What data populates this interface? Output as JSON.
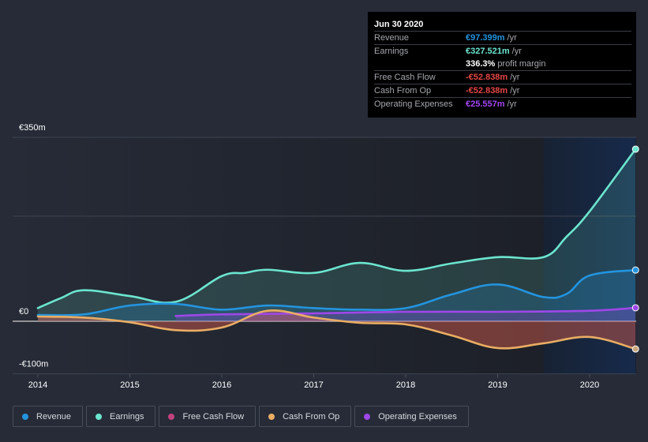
{
  "tooltip": {
    "date": "Jun 30 2020",
    "rows": [
      {
        "label": "Revenue",
        "value": "€97.399m",
        "unit": "/yr",
        "color": "#2394df"
      },
      {
        "label": "Earnings",
        "value": "€327.521m",
        "unit": "/yr",
        "color": "#6ce5cf"
      },
      {
        "label": "",
        "value": "336.3%",
        "unit": "profit margin",
        "color": "#ffffff"
      },
      {
        "label": "Free Cash Flow",
        "value": "-€52.838m",
        "unit": "/yr",
        "color": "#e64646"
      },
      {
        "label": "Cash From Op",
        "value": "-€52.838m",
        "unit": "/yr",
        "color": "#e64646"
      },
      {
        "label": "Operating Expenses",
        "value": "€25.557m",
        "unit": "/yr",
        "color": "#a346f0"
      }
    ]
  },
  "legend": [
    {
      "label": "Revenue",
      "color": "#2394df"
    },
    {
      "label": "Earnings",
      "color": "#6ce5cf"
    },
    {
      "label": "Free Cash Flow",
      "color": "#c2427f"
    },
    {
      "label": "Cash From Op",
      "color": "#e9ad63"
    },
    {
      "label": "Operating Expenses",
      "color": "#9e47e8"
    }
  ],
  "chart_data": {
    "type": "area",
    "title": "",
    "xlabel": "",
    "ylabel": "",
    "currency": "EUR",
    "xlim": [
      2013.7,
      2020.5
    ],
    "ylim": [
      -100,
      350
    ],
    "y_ticks": [
      {
        "value": 350,
        "label": "€350m"
      },
      {
        "value": 0,
        "label": "€0"
      },
      {
        "value": -100,
        "label": "-€100m"
      }
    ],
    "gridlines": [
      350,
      200,
      0,
      -100
    ],
    "x_ticks": [
      {
        "value": 2014,
        "label": "2014"
      },
      {
        "value": 2015,
        "label": "2015"
      },
      {
        "value": 2016,
        "label": "2016"
      },
      {
        "value": 2017,
        "label": "2017"
      },
      {
        "value": 2018,
        "label": "2018"
      },
      {
        "value": 2019,
        "label": "2019"
      },
      {
        "value": 2020,
        "label": "2020"
      }
    ],
    "highlight_range": [
      2019.5,
      2020.5
    ],
    "legend_position": "bottom-left",
    "series": [
      {
        "name": "Earnings",
        "color": "#6ce5cf",
        "x": [
          2014.0,
          2014.25,
          2014.5,
          2015.0,
          2015.5,
          2016.0,
          2016.25,
          2016.5,
          2017.0,
          2017.5,
          2018.0,
          2018.5,
          2019.0,
          2019.5,
          2019.75,
          2020.0,
          2020.5
        ],
        "values": [
          25,
          44,
          59,
          48,
          37,
          86,
          92,
          98,
          92,
          111,
          96,
          110,
          122,
          122,
          161,
          209,
          327.5
        ]
      },
      {
        "name": "Revenue",
        "color": "#2394df",
        "x": [
          2014.0,
          2014.5,
          2015.0,
          2015.5,
          2016.0,
          2016.5,
          2017.0,
          2017.5,
          2018.0,
          2018.5,
          2019.0,
          2019.5,
          2019.75,
          2020.0,
          2020.5
        ],
        "values": [
          12,
          13,
          30,
          33,
          22,
          30,
          25,
          22,
          25,
          51,
          70,
          46,
          52,
          87,
          97.4
        ]
      },
      {
        "name": "Free Cash Flow",
        "color": "#c2427f",
        "x": [
          2014.0,
          2014.5,
          2015.0,
          2015.5,
          2016.0,
          2016.5,
          2017.0,
          2017.5,
          2018.0,
          2018.5,
          2019.0,
          2019.5,
          2020.0,
          2020.5
        ],
        "values": [
          9,
          7,
          -2,
          -17,
          -12,
          20,
          7,
          -3,
          -6,
          -27,
          -51,
          -42,
          -30,
          -52.8
        ]
      },
      {
        "name": "Cash From Op",
        "color": "#e9ad63",
        "x": [
          2014.0,
          2014.5,
          2015.0,
          2015.5,
          2016.0,
          2016.5,
          2017.0,
          2017.5,
          2018.0,
          2018.5,
          2019.0,
          2019.5,
          2020.0,
          2020.5
        ],
        "values": [
          9,
          7,
          -2,
          -17,
          -12,
          20,
          7,
          -3,
          -6,
          -27,
          -51,
          -42,
          -30,
          -52.8
        ]
      },
      {
        "name": "Operating Expenses",
        "color": "#9e47e8",
        "x": [
          2015.5,
          2016.0,
          2017.0,
          2018.0,
          2019.0,
          2020.0,
          2020.5
        ],
        "values": [
          10,
          13,
          15,
          18,
          18,
          20,
          25.6
        ]
      }
    ]
  }
}
